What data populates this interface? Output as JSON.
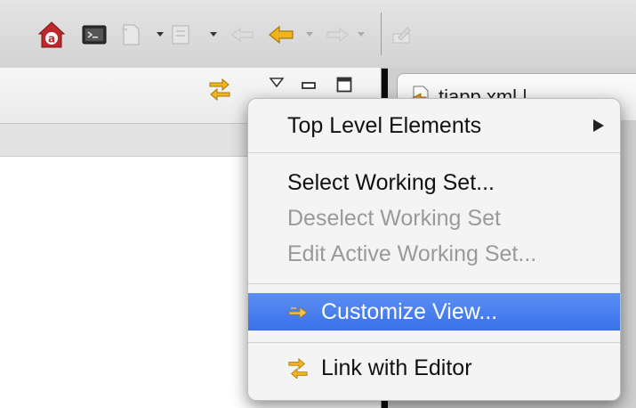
{
  "toolbar": {
    "icons": [
      {
        "name": "app-icon",
        "color": "#c0272d",
        "letter": "a"
      },
      {
        "name": "terminal-icon"
      },
      {
        "name": "new-file-icon"
      },
      {
        "name": "new-project-icon"
      },
      {
        "name": "arrow-left-dim-icon"
      },
      {
        "name": "back-arrow-icon",
        "color": "#f0b41e"
      },
      {
        "name": "forward-arrow-icon"
      },
      {
        "name": "edit-icon"
      }
    ]
  },
  "right_panel": {
    "tab_label": "tiapp.xml | ..."
  },
  "menu": {
    "items": [
      {
        "label": "Top Level Elements",
        "enabled": true,
        "submenu": true
      },
      {
        "label": "Select Working Set...",
        "enabled": true
      },
      {
        "label": "Deselect Working Set",
        "enabled": false
      },
      {
        "label": "Edit Active Working Set...",
        "enabled": false
      },
      {
        "label": "Customize View...",
        "enabled": true,
        "highlighted": true,
        "icon": "customize-arrow-icon"
      },
      {
        "label": "Link with Editor",
        "enabled": true,
        "icon": "link-editor-icon"
      }
    ]
  },
  "colors": {
    "highlight": "#3f76ea",
    "app_red": "#c0272d",
    "back_arrow": "#f0b41e"
  }
}
